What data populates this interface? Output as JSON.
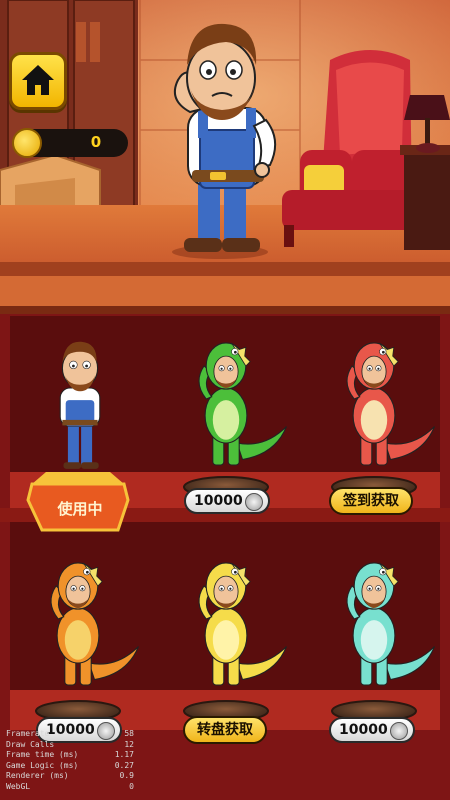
{
  "coins": {
    "value": "0"
  },
  "skins": [
    {
      "name": "hero-default",
      "status": "使用中",
      "colors": {
        "body": "#ffffff"
      }
    },
    {
      "name": "dino-green",
      "price": "10000",
      "colors": {
        "body": "#4cbf3a",
        "belly": "#d6f0a0"
      }
    },
    {
      "name": "dino-red",
      "action": "签到获取",
      "colors": {
        "body": "#e8574a",
        "belly": "#f7e2b0"
      }
    },
    {
      "name": "dino-orange",
      "price": "10000",
      "colors": {
        "body": "#f0922a",
        "belly": "#f6d26a"
      }
    },
    {
      "name": "dino-yellow",
      "action": "转盘获取",
      "colors": {
        "body": "#f5dc4a",
        "belly": "#fff3a8"
      }
    },
    {
      "name": "dino-teal",
      "price": "10000",
      "colors": {
        "body": "#78e0cf",
        "belly": "#d6f5ee"
      }
    }
  ],
  "debug": [
    {
      "label": "Framerate",
      "value": "58"
    },
    {
      "label": "Draw Calls",
      "value": "12"
    },
    {
      "label": "Frame time (ms)",
      "value": "1.17"
    },
    {
      "label": "Game Logic (ms)",
      "value": "0.27"
    },
    {
      "label": "Renderer (ms)",
      "value": "0.9"
    },
    {
      "label": "WebGL",
      "value": "0"
    }
  ]
}
